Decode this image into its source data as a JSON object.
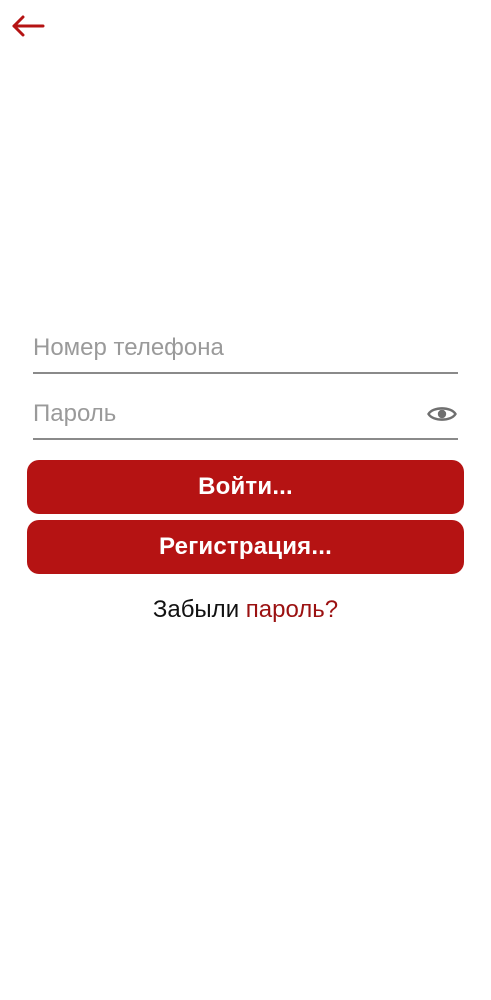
{
  "header": {
    "back_icon": "arrow-left-icon"
  },
  "colors": {
    "accent": "#b51313",
    "link": "#9b1111",
    "placeholder": "#9a9a9a",
    "underline": "#8a8a8a"
  },
  "form": {
    "phone": {
      "placeholder": "Номер телефона",
      "value": ""
    },
    "password": {
      "placeholder": "Пароль",
      "value": "",
      "toggle_icon": "eye-icon"
    },
    "login_label": "Войти...",
    "register_label": "Регистрация...",
    "forgot_prefix": "Забыли",
    "forgot_link": "пароль?"
  }
}
